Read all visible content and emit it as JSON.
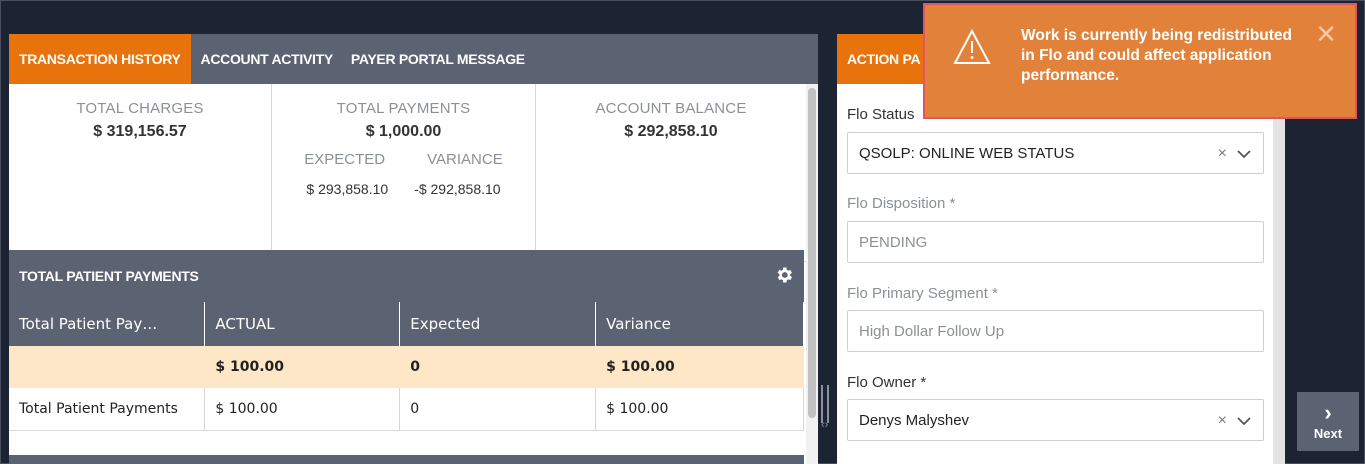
{
  "tabs": [
    {
      "label": "TRANSACTION HISTORY",
      "active": true
    },
    {
      "label": "ACCOUNT ACTIVITY",
      "active": false
    },
    {
      "label": "PAYER PORTAL MESSAGE",
      "active": false
    }
  ],
  "summary": {
    "total_charges": {
      "label": "TOTAL CHARGES",
      "value": "$ 319,156.57"
    },
    "total_payments": {
      "label": "TOTAL PAYMENTS",
      "value": "$ 1,000.00"
    },
    "expected": {
      "label": "EXPECTED",
      "value": "$ 293,858.10"
    },
    "variance": {
      "label": "VARIANCE",
      "value": "-$ 292,858.10"
    },
    "account_balance": {
      "label": "ACCOUNT BALANCE",
      "value": "$ 292,858.10"
    }
  },
  "patient_payments": {
    "title": "TOTAL PATIENT PAYMENTS",
    "columns": [
      "Total Patient Pay…",
      "ACTUAL",
      "Expected",
      "Variance"
    ],
    "rows": [
      [
        "",
        "$ 100.00",
        "0",
        "$ 100.00"
      ],
      [
        "Total Patient Payments",
        "$ 100.00",
        "0",
        "$ 100.00"
      ]
    ]
  },
  "action_panel": {
    "header": "ACTION PA",
    "flo_status": {
      "label": "Flo Status",
      "value": "QSOLP: ONLINE WEB STATUS"
    },
    "flo_disposition": {
      "label": "Flo Disposition *",
      "value": "PENDING"
    },
    "flo_primary_segment": {
      "label": "Flo Primary Segment *",
      "value": "High Dollar Follow Up"
    },
    "flo_owner": {
      "label": "Flo Owner *",
      "value": "Denys Malyshev"
    }
  },
  "next_button": {
    "label": "Next"
  },
  "toast": {
    "message": "Work is currently being redistributed in Flo and could affect application performance.",
    "close_glyph": "✕"
  },
  "colors": {
    "accent": "#e8730c",
    "header_bg": "#5b6272",
    "highlight_row": "#fde7c6",
    "toast_bg": "#e2823a",
    "toast_border": "#e05560"
  }
}
